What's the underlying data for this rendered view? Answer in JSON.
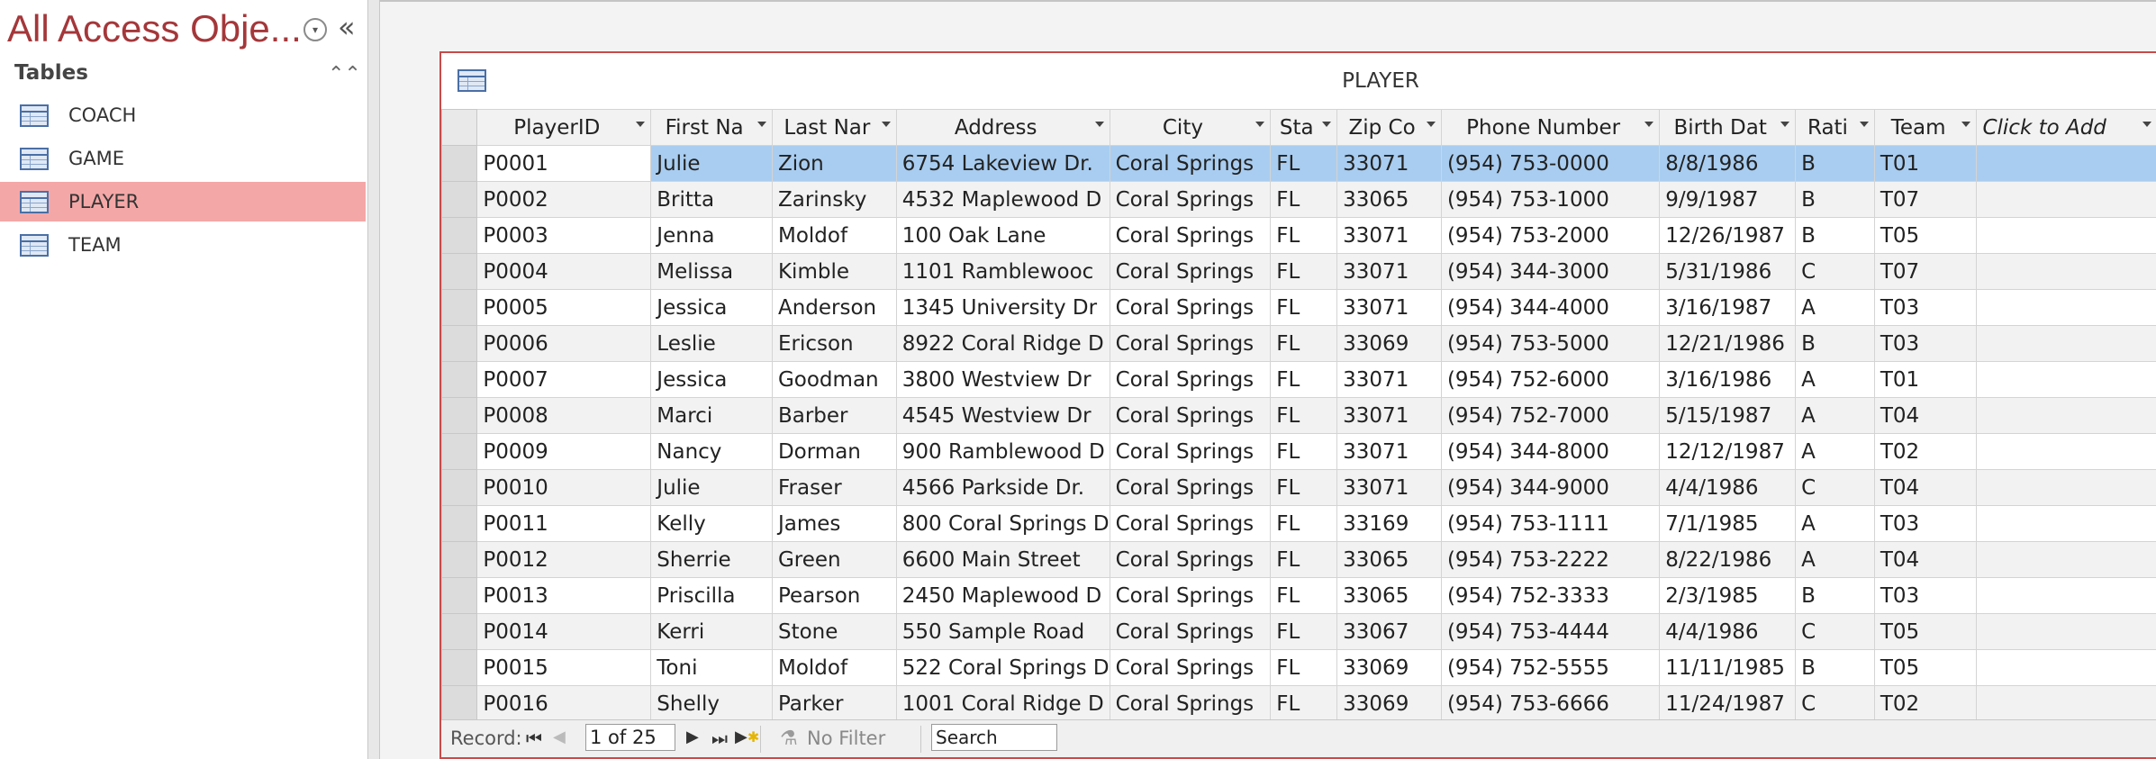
{
  "nav": {
    "title": "All Access Obje...",
    "menu_icon": "chevron-down-circle-icon",
    "collapse_icon": "double-chevron-left-icon",
    "collapse_label": "«",
    "group_label": "Tables",
    "group_toggle_label": "⌃",
    "items": [
      {
        "label": "COACH",
        "icon": "table-icon",
        "selected": false
      },
      {
        "label": "GAME",
        "icon": "table-icon",
        "selected": false
      },
      {
        "label": "PLAYER",
        "icon": "table-icon",
        "selected": true
      },
      {
        "label": "TEAM",
        "icon": "table-icon",
        "selected": false
      }
    ]
  },
  "document": {
    "tab_title": "PLAYER",
    "columns": [
      "PlayerID",
      "First Na",
      "Last Nar",
      "Address",
      "City",
      "Sta",
      "Zip Co",
      "Phone Number",
      "Birth Dat",
      "Rati",
      "Team",
      "Click to Add"
    ],
    "rows": [
      [
        "P0001",
        "Julie",
        "Zion",
        "6754 Lakeview Dr.",
        "Coral Springs",
        "FL",
        "33071",
        "(954) 753-0000",
        "8/8/1986",
        "B",
        "T01"
      ],
      [
        "P0002",
        "Britta",
        "Zarinsky",
        "4532 Maplewood D",
        "Coral Springs",
        "FL",
        "33065",
        "(954) 753-1000",
        "9/9/1987",
        "B",
        "T07"
      ],
      [
        "P0003",
        "Jenna",
        "Moldof",
        "100 Oak Lane",
        "Coral Springs",
        "FL",
        "33071",
        "(954) 753-2000",
        "12/26/1987",
        "B",
        "T05"
      ],
      [
        "P0004",
        "Melissa",
        "Kimble",
        "1101 Ramblewooc",
        "Coral Springs",
        "FL",
        "33071",
        "(954) 344-3000",
        "5/31/1986",
        "C",
        "T07"
      ],
      [
        "P0005",
        "Jessica",
        "Anderson",
        "1345 University Dr",
        "Coral Springs",
        "FL",
        "33071",
        "(954) 344-4000",
        "3/16/1987",
        "A",
        "T03"
      ],
      [
        "P0006",
        "Leslie",
        "Ericson",
        "8922 Coral Ridge D",
        "Coral Springs",
        "FL",
        "33069",
        "(954) 753-5000",
        "12/21/1986",
        "B",
        "T03"
      ],
      [
        "P0007",
        "Jessica",
        "Goodman",
        "3800 Westview Dr",
        "Coral Springs",
        "FL",
        "33071",
        "(954) 752-6000",
        "3/16/1986",
        "A",
        "T01"
      ],
      [
        "P0008",
        "Marci",
        "Barber",
        "4545 Westview Dr",
        "Coral Springs",
        "FL",
        "33071",
        "(954) 752-7000",
        "5/15/1987",
        "A",
        "T04"
      ],
      [
        "P0009",
        "Nancy",
        "Dorman",
        "900 Ramblewood D",
        "Coral Springs",
        "FL",
        "33071",
        "(954) 344-8000",
        "12/12/1987",
        "A",
        "T02"
      ],
      [
        "P0010",
        "Julie",
        "Fraser",
        "4566 Parkside Dr.",
        "Coral Springs",
        "FL",
        "33071",
        "(954) 344-9000",
        "4/4/1986",
        "C",
        "T04"
      ],
      [
        "P0011",
        "Kelly",
        "James",
        "800 Coral Springs D",
        "Coral Springs",
        "FL",
        "33169",
        "(954) 753-1111",
        "7/1/1985",
        "A",
        "T03"
      ],
      [
        "P0012",
        "Sherrie",
        "Green",
        "6600 Main Street",
        "Coral Springs",
        "FL",
        "33065",
        "(954) 753-2222",
        "8/22/1986",
        "A",
        "T04"
      ],
      [
        "P0013",
        "Priscilla",
        "Pearson",
        "2450 Maplewood D",
        "Coral Springs",
        "FL",
        "33065",
        "(954) 752-3333",
        "2/3/1985",
        "B",
        "T03"
      ],
      [
        "P0014",
        "Kerri",
        "Stone",
        "550 Sample Road",
        "Coral Springs",
        "FL",
        "33067",
        "(954) 753-4444",
        "4/4/1986",
        "C",
        "T05"
      ],
      [
        "P0015",
        "Toni",
        "Moldof",
        "522 Coral Springs D",
        "Coral Springs",
        "FL",
        "33069",
        "(954) 752-5555",
        "11/11/1985",
        "B",
        "T05"
      ],
      [
        "P0016",
        "Shelly",
        "Parker",
        "1001 Coral Ridge D",
        "Coral Springs",
        "FL",
        "33069",
        "(954) 753-6666",
        "11/24/1987",
        "C",
        "T02"
      ]
    ],
    "current_row": 0
  },
  "record_nav": {
    "label": "Record:",
    "first_icon": "first-record-icon",
    "first_glyph": "⏮",
    "prev_glyph": "◀",
    "current": "1 of 25",
    "next_glyph": "▶",
    "last_glyph": "⏭",
    "new_glyph": "▶",
    "new_star": "✱",
    "filter_icon": "funnel-icon",
    "filter_glyph": "⚗",
    "filter_label": "No Filter",
    "search_value": "Search"
  },
  "colors": {
    "accent": "#a4373a",
    "selected_nav": "#f4a7a7",
    "current_row": "#a9cdf0",
    "doc_border": "#c84a4a"
  }
}
